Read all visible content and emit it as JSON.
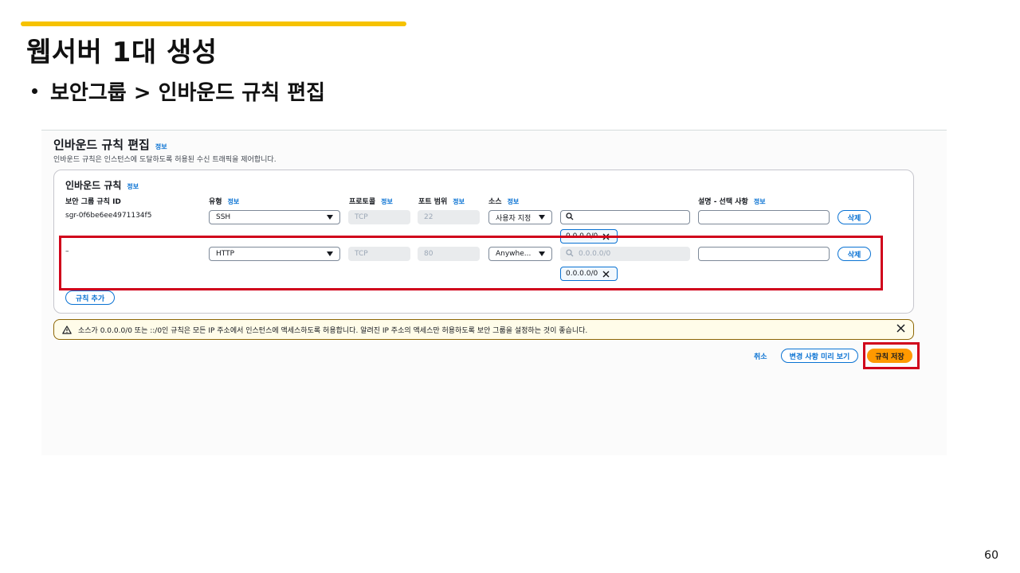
{
  "slide": {
    "title": "웹서버 1대 생성",
    "bullet": "보안그룹 > 인바운드 규칙 편집",
    "page_number": "60",
    "accent_color": "#f6c200",
    "highlight_color": "#d0021b"
  },
  "panel": {
    "title": "인바운드 규칙 편집",
    "info": "정보",
    "description": "인바운드 규칙은 인스턴스에 도달하도록 허용된 수신 트래픽을 제어합니다."
  },
  "rules_card": {
    "title": "인바운드 규칙",
    "info": "정보",
    "columns": {
      "rule_id": "보안 그룹 규칙 ID",
      "type": "유형",
      "protocol": "프로토콜",
      "port_range": "포트 범위",
      "source": "소스",
      "description": "설명 - 선택 사항",
      "info": "정보"
    },
    "rows": [
      {
        "rule_id": "sgr-0f6be6ee4971134f5",
        "type": "SSH",
        "protocol": "TCP",
        "port": "22",
        "source": "사용자 지정",
        "search_value": "",
        "cidr_token": "0.0.0.0/0",
        "description": "",
        "delete_label": "삭제"
      },
      {
        "rule_id": "–",
        "type": "HTTP",
        "protocol": "TCP",
        "port": "80",
        "source": "Anywhe...",
        "search_placeholder": "0.0.0.0/0",
        "cidr_token": "0.0.0.0/0",
        "description": "",
        "delete_label": "삭제"
      }
    ],
    "add_rule_label": "규칙 추가"
  },
  "warning": {
    "text": "소스가 0.0.0.0/0 또는 ::/0인 규칙은 모든 IP 주소에서 인스턴스에 액세스하도록 허용합니다. 알려진 IP 주소의 액세스만 허용하도록 보안 그룹을 설정하는 것이 좋습니다."
  },
  "footer": {
    "cancel_label": "취소",
    "preview_label": "변경 사항 미리 보기",
    "save_label": "규칙 저장"
  },
  "colors": {
    "primary_button": "#ff9900",
    "link_blue": "#0972d3",
    "warning_bg": "#fffce9",
    "warning_border": "#8d6605"
  }
}
